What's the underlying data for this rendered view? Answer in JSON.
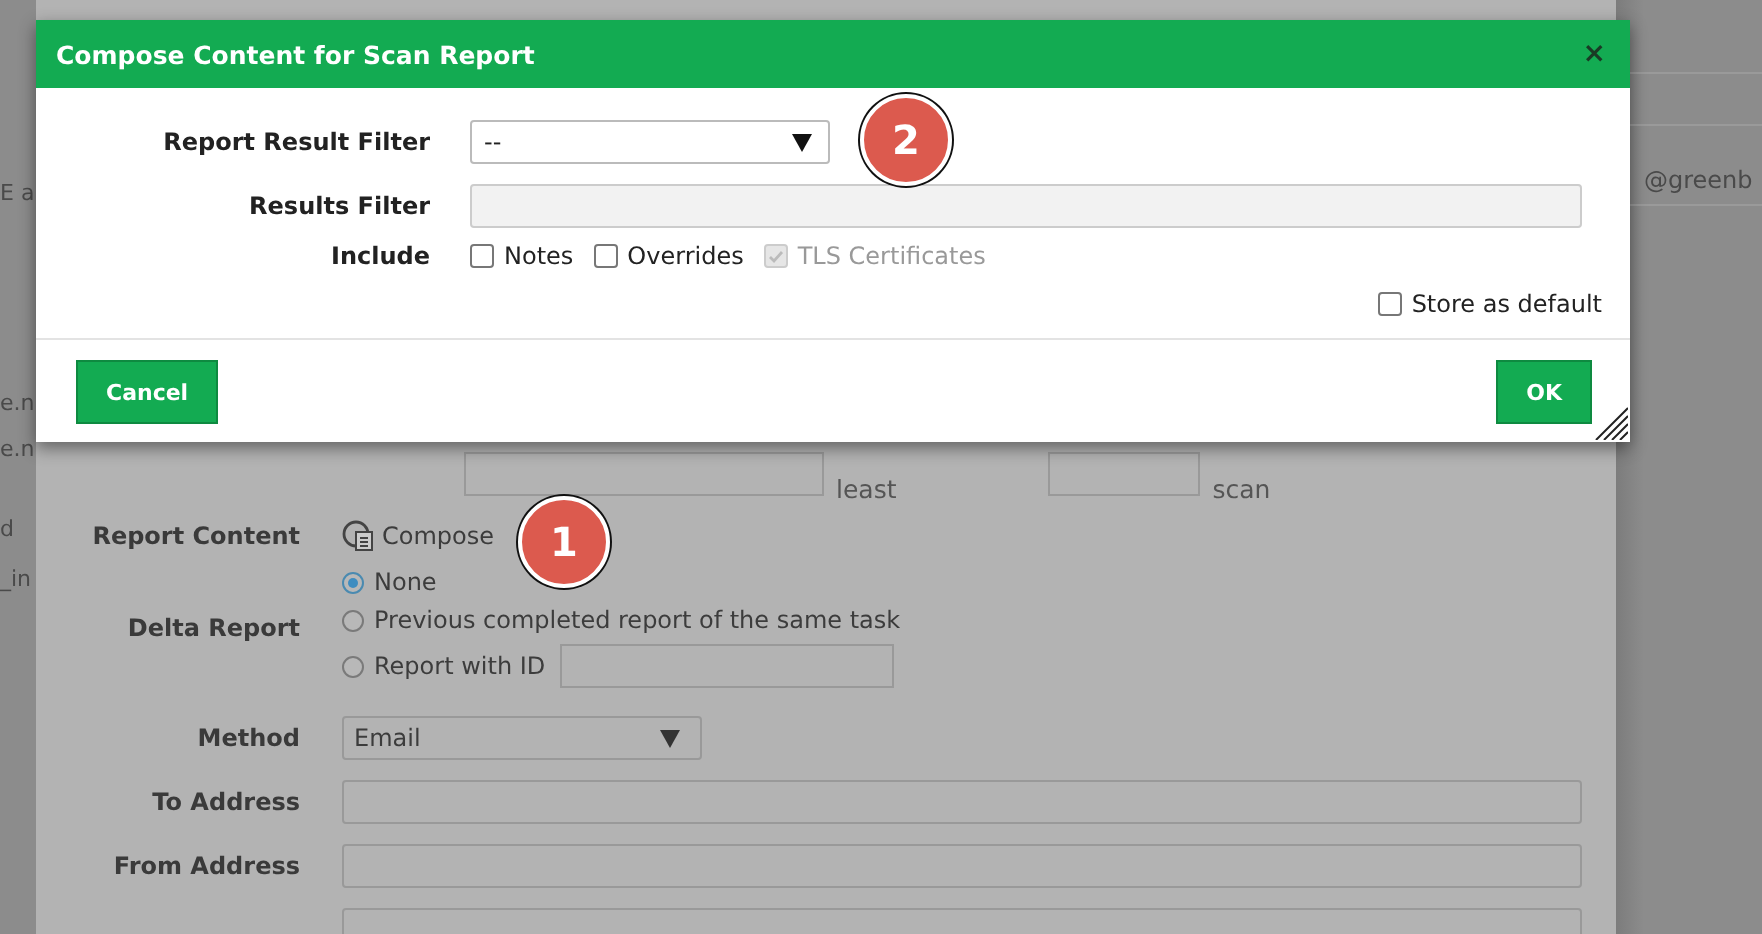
{
  "background_page": {
    "left_fragments": [
      "E a",
      "e.n",
      "e.n",
      "d",
      "_in"
    ],
    "right_fragments": [
      "@greenb"
    ]
  },
  "back_dialog": {
    "filter_row": {
      "texts": [
        "least",
        "scan"
      ]
    },
    "report_content": {
      "label": "Report Content",
      "action": "Compose"
    },
    "delta_report": {
      "label": "Delta Report",
      "options": [
        {
          "label": "None",
          "selected": true,
          "kind": "plain"
        },
        {
          "label": "Previous completed report of the same task",
          "selected": false,
          "kind": "plain"
        },
        {
          "label": "Report with ID",
          "selected": false,
          "kind": "with_field"
        }
      ]
    },
    "method": {
      "label": "Method",
      "value": "Email"
    },
    "to_address": {
      "label": "To Address"
    },
    "from_address": {
      "label": "From Address"
    }
  },
  "dialog": {
    "title": "Compose Content for Scan Report",
    "close": "×",
    "report_result_filter": {
      "label": "Report Result Filter",
      "value": "--"
    },
    "results_filter": {
      "label": "Results Filter"
    },
    "include": {
      "label": "Include",
      "options": [
        {
          "label": "Notes",
          "checked": false,
          "disabled": false
        },
        {
          "label": "Overrides",
          "checked": false,
          "disabled": false
        },
        {
          "label": "TLS Certificates",
          "checked": true,
          "disabled": true
        }
      ]
    },
    "store_as_default": {
      "label": "Store as default",
      "checked": false
    },
    "buttons": [
      {
        "label": "Cancel"
      },
      {
        "label": "OK"
      }
    ]
  },
  "callouts": [
    "1",
    "2"
  ]
}
